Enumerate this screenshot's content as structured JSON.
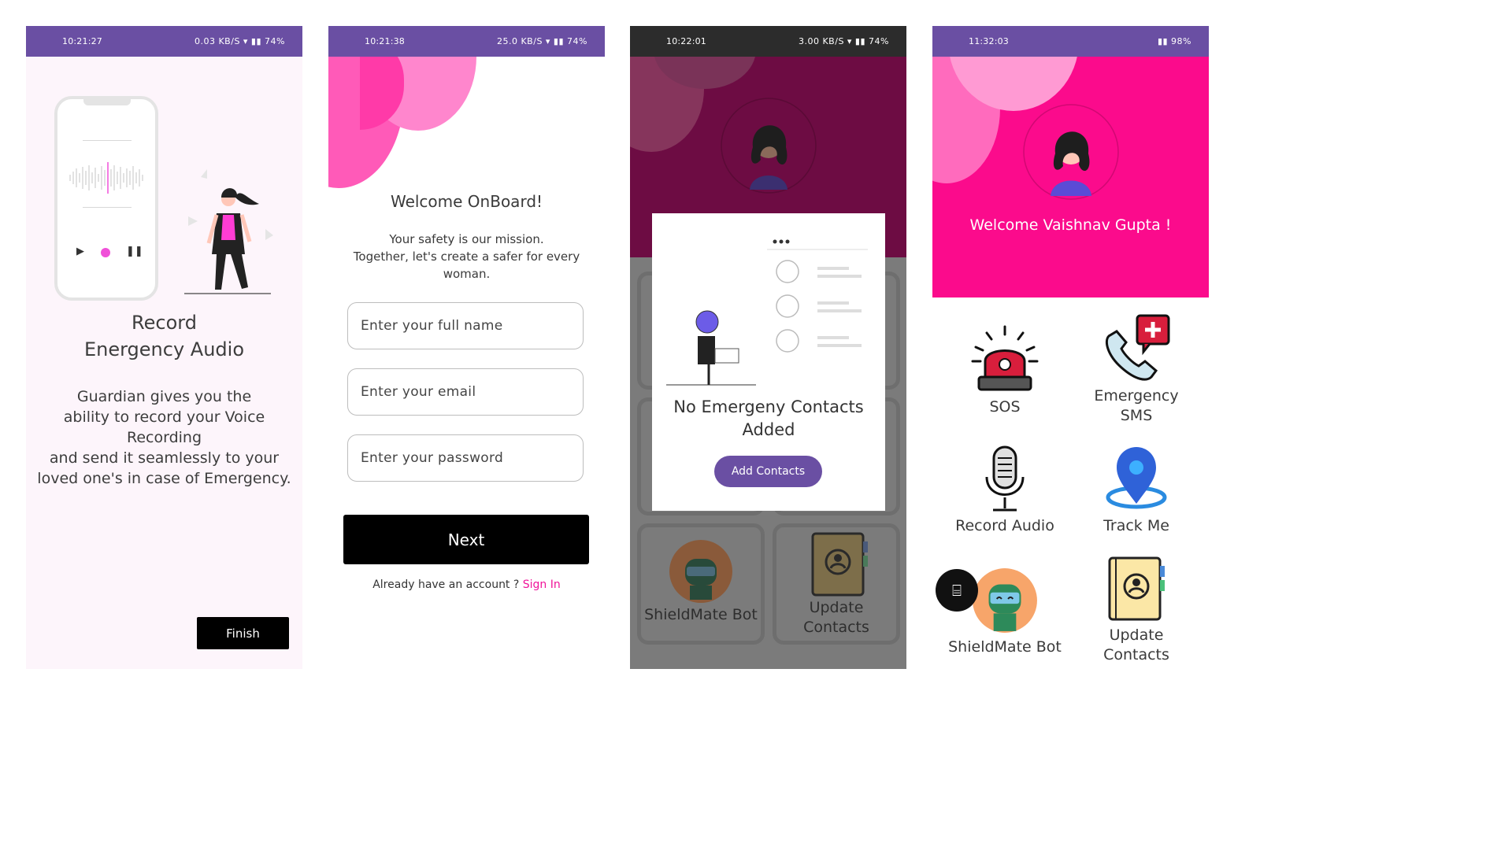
{
  "screen1": {
    "status": {
      "time": "10:21:27",
      "right": "0.03 KB/S ▾ ▮▮ 74%"
    },
    "title_line1": "Record",
    "title_line2": "Energency Audio",
    "desc_line1": "Guardian gives you the",
    "desc_line2": "ability to record your Voice Recording",
    "desc_line3": "and send it seamlessly to your",
    "desc_line4": "loved one's in case of Emergency.",
    "finish_label": "Finish"
  },
  "screen2": {
    "status": {
      "time": "10:21:38",
      "right": "25.0 KB/S ▾ ▮▮ 74%"
    },
    "title": "Welcome OnBoard!",
    "sub_line1": "Your safety is our mission.",
    "sub_line2": "Together, let's create a safer for every",
    "sub_line3": "woman.",
    "name_placeholder": "Enter your full name",
    "email_placeholder": "Enter your email",
    "password_placeholder": "Enter your password",
    "next_label": "Next",
    "have_account": "Already have an account ? ",
    "signin_label": "Sign In",
    "accent": "#f0149a"
  },
  "screen3": {
    "status": {
      "time": "10:22:01",
      "right": "3.00 KB/S ▾ ▮▮ 74%"
    },
    "dialog_title_line1": "No Emergeny Contacts",
    "dialog_title_line2": "Added",
    "add_label": "Add Contacts",
    "bot_label": "ShieldMate Bot",
    "update_line1": "Update",
    "update_line2": "Contacts"
  },
  "screen4": {
    "status": {
      "time": "11:32:03",
      "right": "▮▮ 98%"
    },
    "welcome": "Welcome Vaishnav Gupta !",
    "sos_label": "SOS",
    "sms_line1": "Emergency",
    "sms_line2": "SMS",
    "record_label": "Record Audio",
    "track_label": "Track Me",
    "bot_label": "ShieldMate Bot",
    "update_line1": "Update",
    "update_line2": "Contacts",
    "accent": "#fb0b8c"
  }
}
